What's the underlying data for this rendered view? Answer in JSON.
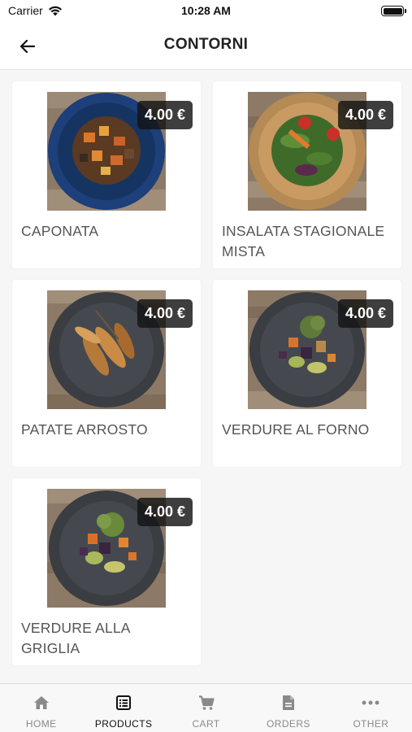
{
  "status_bar": {
    "carrier": "Carrier",
    "time": "10:28 AM"
  },
  "header": {
    "title": "CONTORNI"
  },
  "products": [
    {
      "name": "CAPONATA",
      "price": "4.00 €"
    },
    {
      "name": "INSALATA STAGIONALE MISTA",
      "price": "4.00 €"
    },
    {
      "name": "PATATE ARROSTO",
      "price": "4.00 €"
    },
    {
      "name": "VERDURE AL FORNO",
      "price": "4.00 €"
    },
    {
      "name": "VERDURE ALLA GRIGLIA",
      "price": "4.00 €"
    }
  ],
  "tabbar": {
    "items": [
      {
        "label": "HOME",
        "icon": "home-icon"
      },
      {
        "label": "PRODUCTS",
        "icon": "list-icon"
      },
      {
        "label": "CART",
        "icon": "cart-icon"
      },
      {
        "label": "ORDERS",
        "icon": "document-icon"
      },
      {
        "label": "OTHER",
        "icon": "more-icon"
      }
    ],
    "active": "PRODUCTS"
  },
  "colors": {
    "accent": "#111111",
    "inactive_tab": "#8a8a8a",
    "price_badge": "#141414"
  }
}
